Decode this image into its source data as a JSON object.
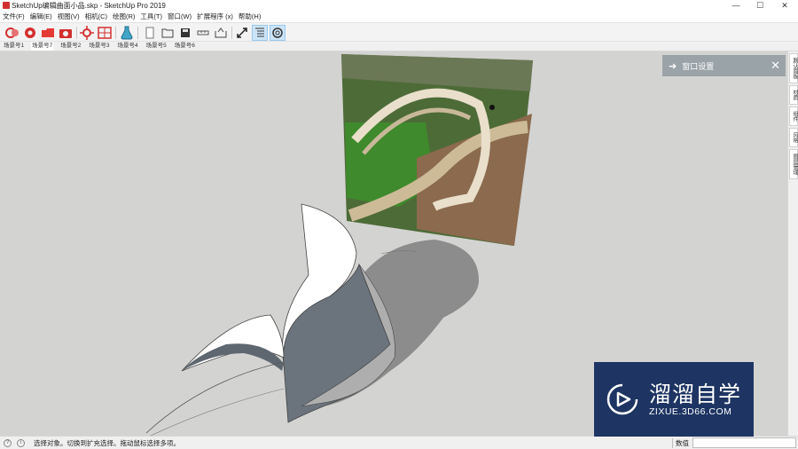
{
  "window": {
    "title": "SketchUp编辑曲面小品.skp - SketchUp Pro 2019",
    "minimize": "—",
    "maximize": "☐",
    "close": "✕"
  },
  "menu": [
    "文件(F)",
    "编辑(E)",
    "视图(V)",
    "相机(C)",
    "绘图(R)",
    "工具(T)",
    "窗口(W)",
    "扩展程序 (x)",
    "帮助(H)"
  ],
  "toolbar": {
    "icons": [
      "extension-warehouse-icon",
      "settings-gear-icon",
      "folder-red-icon",
      "camera-icon",
      "sun-gear-icon",
      "grid-icon",
      "potion-flask-icon",
      "new-page-icon",
      "open-folder-icon",
      "save-icon",
      "ruler-icon",
      "export-icon",
      "fullscreen-icon",
      "outliner-icon",
      "tray-settings-icon"
    ]
  },
  "scenes": [
    "场景号1",
    "场景号7",
    "场景号2",
    "场景号3",
    "场景号4",
    "场景号5",
    "场景号6"
  ],
  "tray_panel": {
    "title": "窗口设置",
    "close": "✕"
  },
  "side_tabs": [
    "默认面板",
    "材质",
    "组件",
    "风格",
    "图层管理"
  ],
  "status": {
    "hint": "选择对象。切换到扩充选择。拖动鼠标选择多项。",
    "measure_label": "数值",
    "measure_value": ""
  },
  "watermark": {
    "title": "溜溜自学",
    "subtitle": "ZIXUE.3D66.COM"
  },
  "colors": {
    "viewport_bg": "#d3d3d1",
    "tray_bg": "#9aa3a8",
    "watermark_bg": "#1e3563"
  }
}
